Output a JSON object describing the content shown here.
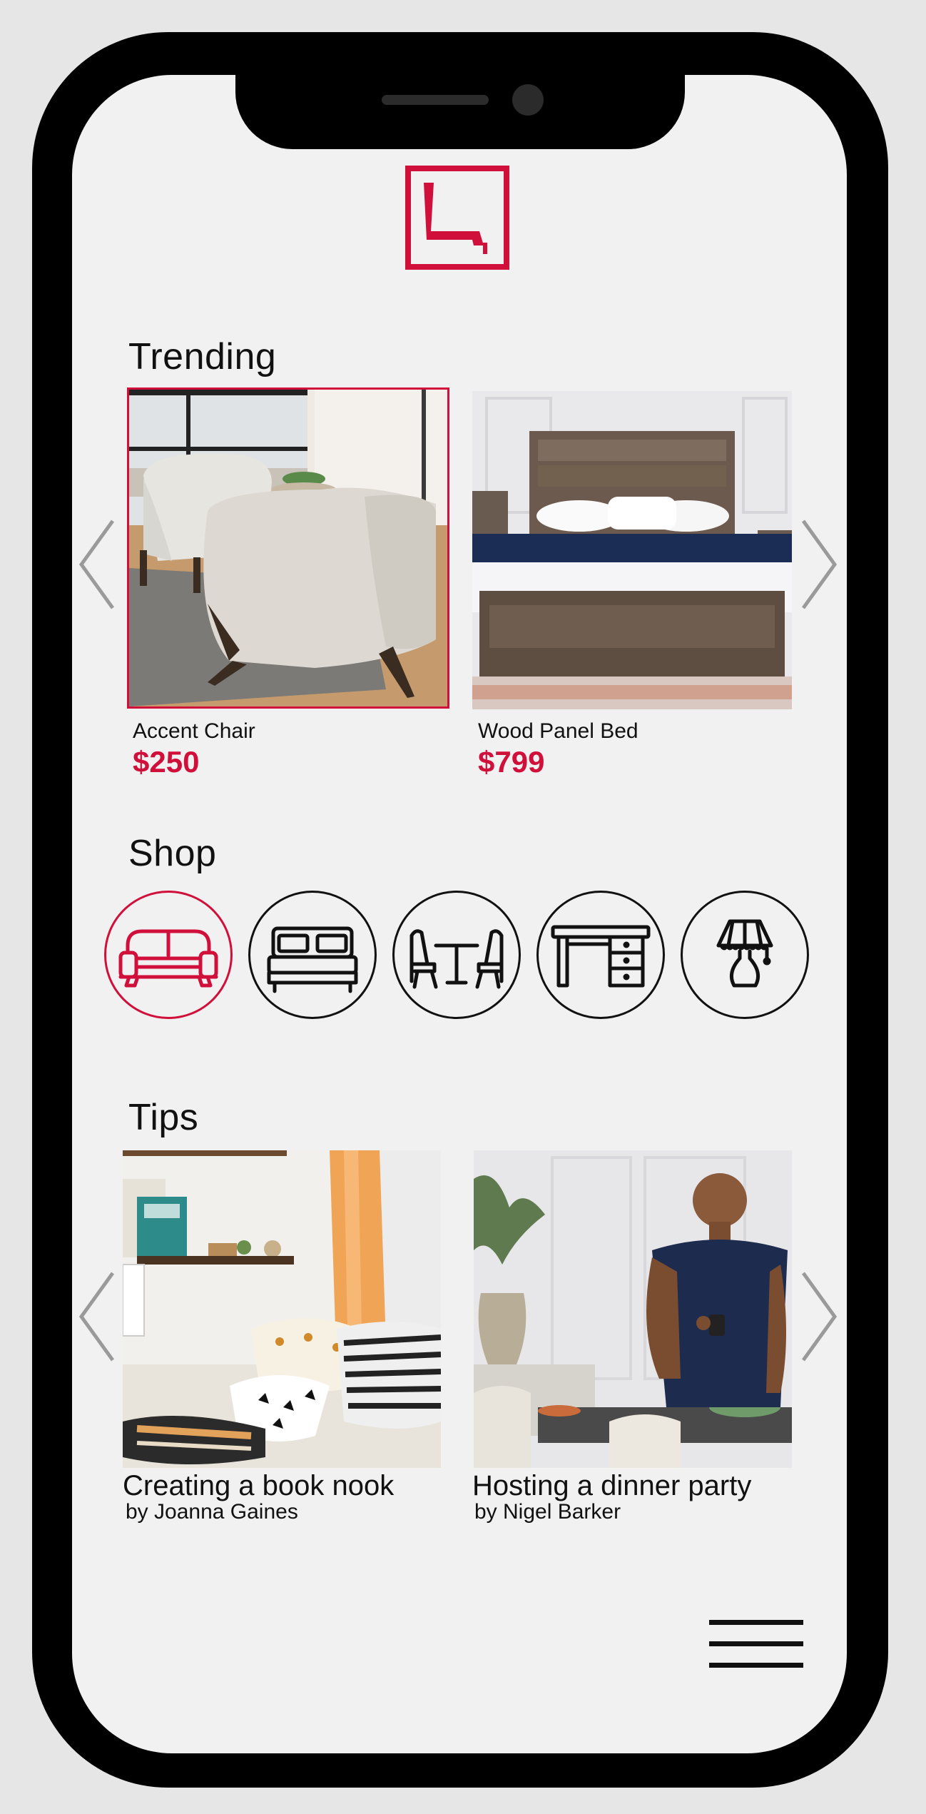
{
  "trending": {
    "title": "Trending",
    "items": [
      {
        "name": "Accent Chair",
        "price": "$250"
      },
      {
        "name": "Wood Panel Bed",
        "price": "$799"
      }
    ]
  },
  "shop": {
    "title": "Shop",
    "categories": [
      "sofa-icon",
      "bed-icon",
      "dining-set-icon",
      "desk-icon",
      "lamp-icon"
    ]
  },
  "tips": {
    "title": "Tips",
    "items": [
      {
        "title": "Creating a book nook",
        "author": "by Joanna Gaines"
      },
      {
        "title": "Hosting a dinner party",
        "author": "by Nigel Barker"
      }
    ]
  },
  "colors": {
    "accent": "#d0103a",
    "text": "#111111",
    "background": "#f1f1f1"
  }
}
